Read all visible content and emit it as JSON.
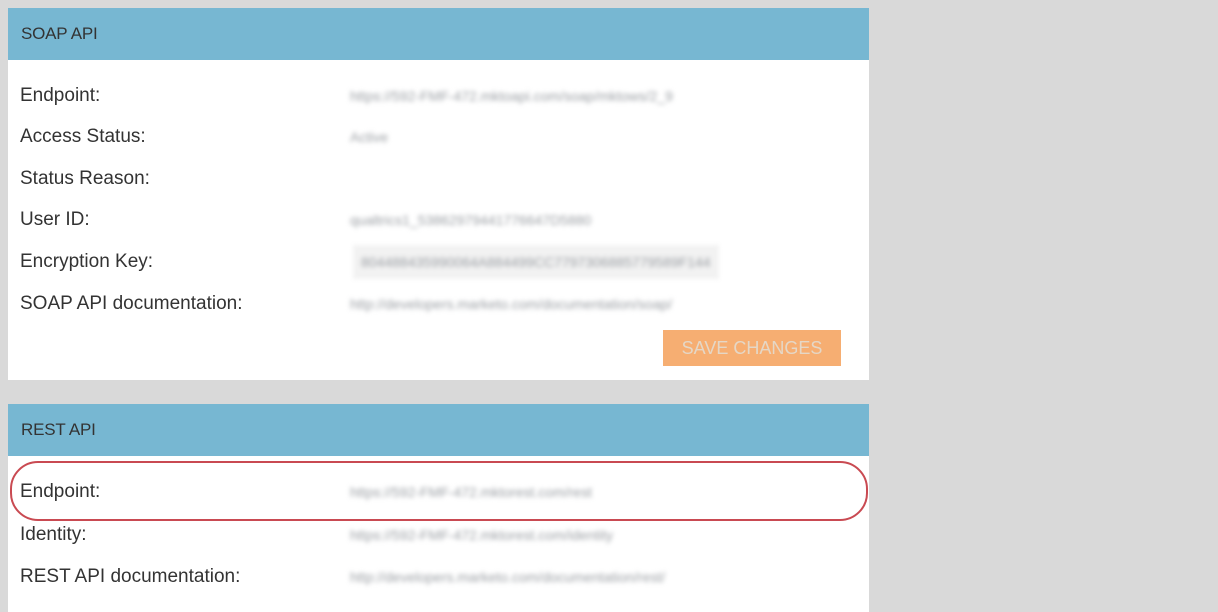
{
  "soap": {
    "header": "SOAP API",
    "rows": [
      {
        "label": "Endpoint:",
        "value": "https://592-FMF-472.mktoapi.com/soap/mktows/2_9"
      },
      {
        "label": "Access Status:",
        "value": "Active"
      },
      {
        "label": "Status Reason:",
        "value": ""
      },
      {
        "label": "User ID:",
        "value": "qualtrics1_53862979441776647D5880"
      },
      {
        "label": "Encryption Key:",
        "value": "804488435990064A884499CC7797306885779589F144"
      },
      {
        "label": "SOAP API documentation:",
        "value": "http://developers.marketo.com/documentation/soap/"
      }
    ],
    "save_label": "SAVE CHANGES"
  },
  "rest": {
    "header": "REST API",
    "rows": [
      {
        "label": "Endpoint:",
        "value": "https://592-FMF-472.mktorest.com/rest"
      },
      {
        "label": "Identity:",
        "value": "https://592-FMF-472.mktorest.com/identity"
      },
      {
        "label": "REST API documentation:",
        "value": "http://developers.marketo.com/documentation/rest/"
      }
    ]
  },
  "colors": {
    "header_bg": "#77b7d2",
    "button_bg": "#f6ae72",
    "highlight": "#c94a52"
  }
}
